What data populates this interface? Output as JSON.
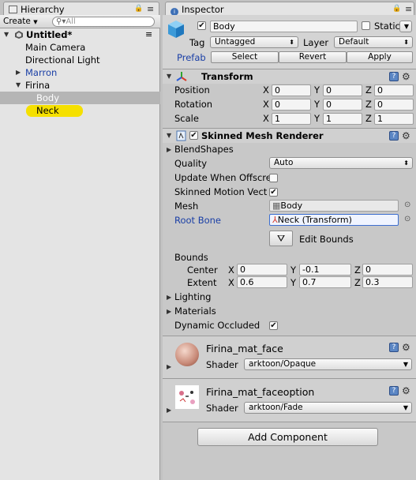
{
  "hierarchy": {
    "tab_label": "Hierarchy",
    "create_label": "Create",
    "search_placeholder": "All",
    "scene_name": "Untitled*",
    "items": [
      {
        "label": "Main Camera"
      },
      {
        "label": "Directional Light"
      },
      {
        "label": "Marron"
      },
      {
        "label": "Firina"
      },
      {
        "label": "Body"
      },
      {
        "label": "Neck"
      }
    ]
  },
  "inspector": {
    "tab_label": "Inspector",
    "object": {
      "name": "Body",
      "active": true,
      "static_label": "Static",
      "tag_label": "Tag",
      "tag_value": "Untagged",
      "layer_label": "Layer",
      "layer_value": "Default",
      "prefab_label": "Prefab",
      "select_label": "Select",
      "revert_label": "Revert",
      "apply_label": "Apply"
    },
    "transform": {
      "title": "Transform",
      "rows": [
        {
          "label": "Position",
          "x": "0",
          "y": "0",
          "z": "0"
        },
        {
          "label": "Rotation",
          "x": "0",
          "y": "0",
          "z": "0"
        },
        {
          "label": "Scale",
          "x": "1",
          "y": "1",
          "z": "1"
        }
      ]
    },
    "smr": {
      "title": "Skinned Mesh Renderer",
      "blendshapes_label": "BlendShapes",
      "quality_label": "Quality",
      "quality_value": "Auto",
      "update_offscreen_label": "Update When Offscre",
      "update_offscreen_checked": false,
      "motion_vectors_label": "Skinned Motion Vect",
      "motion_vectors_checked": true,
      "mesh_label": "Mesh",
      "mesh_value": "Body",
      "rootbone_label": "Root Bone",
      "rootbone_value": "Neck (Transform)",
      "edit_bounds_label": "Edit Bounds",
      "bounds_label": "Bounds",
      "center_label": "Center",
      "center": {
        "x": "0",
        "y": "-0.1",
        "z": "0"
      },
      "extent_label": "Extent",
      "extent": {
        "x": "0.6",
        "y": "0.7",
        "z": "0.3"
      },
      "lighting_label": "Lighting",
      "materials_label": "Materials",
      "dynamic_occluded_label": "Dynamic Occluded",
      "dynamic_occluded_checked": true
    },
    "materials": [
      {
        "name": "Firina_mat_face",
        "shader_label": "Shader",
        "shader_value": "arktoon/Opaque"
      },
      {
        "name": "Firina_mat_faceoption",
        "shader_label": "Shader",
        "shader_value": "arktoon/Fade"
      }
    ],
    "add_component_label": "Add Component"
  },
  "colors": {
    "selection_gray": "#b5b5b5",
    "highlight_yellow": "#f5e000",
    "prefab_blue": "#1a3fa6"
  }
}
